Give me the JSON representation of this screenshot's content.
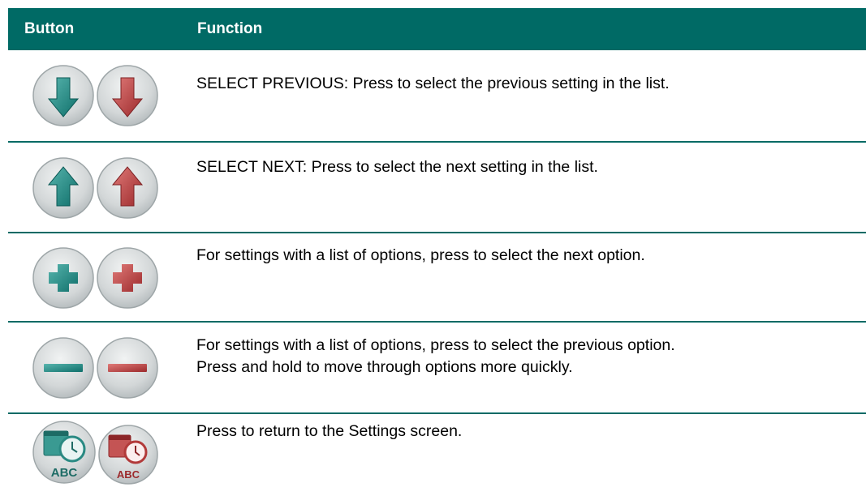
{
  "header": {
    "button": "Button",
    "function": "Function"
  },
  "rows": [
    {
      "icon": "arrow-down-icon",
      "lines": [
        "SELECT PREVIOUS: Press to select the previous setting in the list."
      ]
    },
    {
      "icon": "arrow-up-icon",
      "lines": [
        "SELECT NEXT: Press to select the next setting in the list."
      ]
    },
    {
      "icon": "plus-icon",
      "lines": [
        "For settings with a list of options, press to select the next option."
      ]
    },
    {
      "icon": "minus-icon",
      "lines": [
        "For settings with a list of options, press to select the previous option.",
        "Press and hold to move through options more quickly."
      ]
    },
    {
      "icon": "settings-clock-icon",
      "lines": [
        "Press to return to the Settings screen."
      ],
      "icon_text": "ABC"
    }
  ],
  "colors": {
    "header_bg": "#006a65",
    "rule": "#006a65",
    "teal": "#1f8c86",
    "red": "#b23a3a",
    "button_face": "#d6dadb"
  }
}
